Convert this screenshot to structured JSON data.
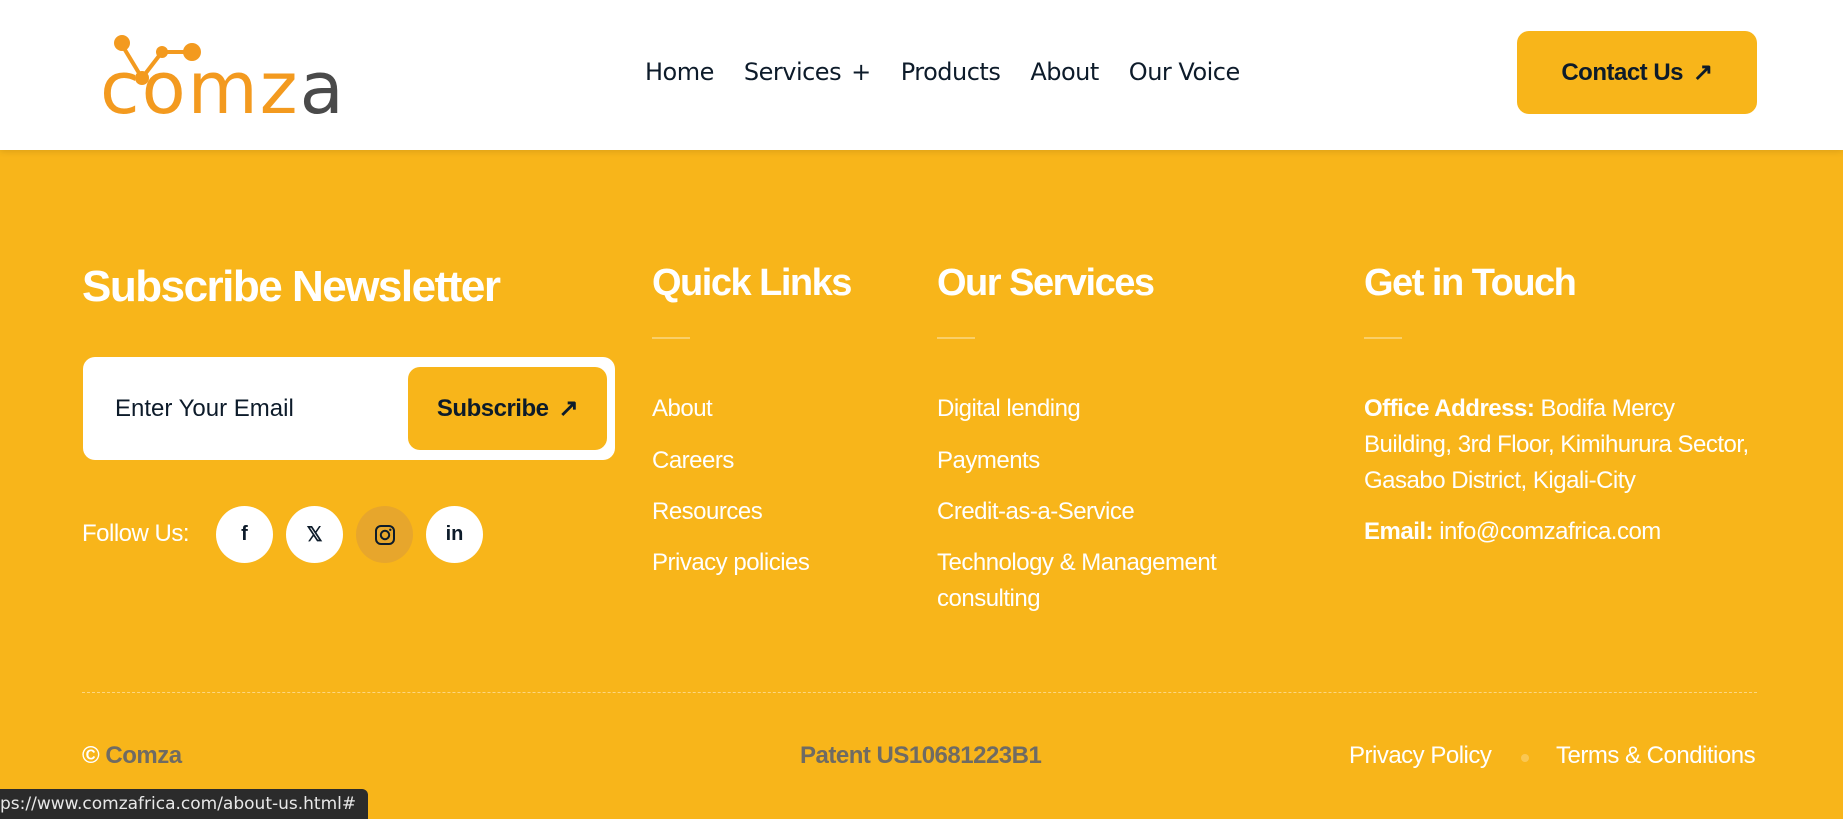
{
  "header": {
    "logo_text": "comza",
    "nav": [
      {
        "label": "Home"
      },
      {
        "label": "Services",
        "has_submenu": true,
        "submenu_icon": "+"
      },
      {
        "label": "Products"
      },
      {
        "label": "About"
      },
      {
        "label": "Our Voice"
      }
    ],
    "contact_label": "Contact Us",
    "arrow_icon": "↗"
  },
  "newsletter": {
    "title": "Subscribe Newsletter",
    "email_placeholder": "Enter Your Email",
    "subscribe_label": "Subscribe",
    "follow_label": "Follow Us:",
    "social": [
      {
        "icon": "facebook-icon",
        "glyph": "f"
      },
      {
        "icon": "x-icon",
        "glyph": "𝕏"
      },
      {
        "icon": "instagram-icon",
        "glyph": ""
      },
      {
        "icon": "linkedin-icon",
        "glyph": "in"
      }
    ]
  },
  "quick_links": {
    "title": "Quick Links",
    "items": [
      "About",
      "Careers",
      "Resources",
      "Privacy policies"
    ]
  },
  "services": {
    "title": "Our Services",
    "items": [
      "Digital lending",
      "Payments",
      "Credit-as-a-Service",
      "Technology & Management consulting"
    ]
  },
  "contact": {
    "title": "Get in Touch",
    "address_label": "Office Address:",
    "address_value": "Bodifa Mercy Building, 3rd Floor, Kimihurura Sector, Gasabo District, Kigali-City",
    "email_label": "Email:",
    "email_value": "info@comzafrica.com"
  },
  "bottom": {
    "copyright_symbol": "©",
    "brand": "Comza",
    "patent": "Patent US10681223B1",
    "privacy": "Privacy Policy",
    "terms": "Terms & Conditions"
  },
  "status_url": "ps://www.comzafrica.com/about-us.html#",
  "colors": {
    "brand_yellow": "#F8B51A",
    "logo_orange": "#F39A1F",
    "dark_text": "#0d1b2a",
    "muted_text": "#6f6b63"
  }
}
